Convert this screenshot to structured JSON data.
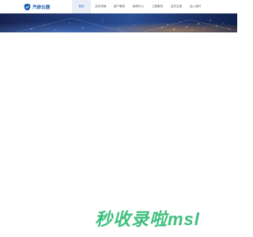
{
  "header": {
    "logo_text": "汽修仪器",
    "nav": [
      {
        "label": "首页",
        "active": true
      },
      {
        "label": "业务领域",
        "active": false
      },
      {
        "label": "客户服务",
        "active": false
      },
      {
        "label": "新闻中心",
        "active": false
      },
      {
        "label": "工程服务",
        "active": false
      },
      {
        "label": "会员互惠",
        "active": false
      },
      {
        "label": "加入我们",
        "active": false
      }
    ]
  },
  "watermark": {
    "text": "秒收录啦msl"
  },
  "colors": {
    "brand": "#1f5fae",
    "active_nav_bg": "#e9eef6",
    "banner_dark": "#16234f",
    "watermark": "#3ebf7c"
  }
}
